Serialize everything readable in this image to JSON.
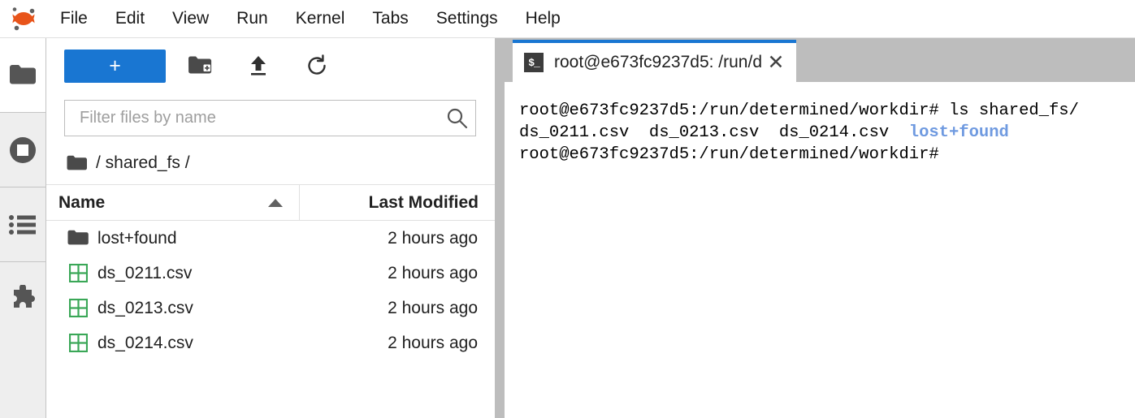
{
  "app": {
    "name": "JupyterLab",
    "logo_icon": "jupyter-logo-icon",
    "accent_color": "#1976d2",
    "logo_color": "#e8541a"
  },
  "menubar": {
    "items": [
      {
        "label": "File"
      },
      {
        "label": "Edit"
      },
      {
        "label": "View"
      },
      {
        "label": "Run"
      },
      {
        "label": "Kernel"
      },
      {
        "label": "Tabs"
      },
      {
        "label": "Settings"
      },
      {
        "label": "Help"
      }
    ]
  },
  "sidebar_rail": {
    "items": [
      {
        "icon": "folder-icon",
        "name": "file-browser",
        "active": true
      },
      {
        "icon": "running-terminals-icon",
        "name": "running-sessions",
        "active": false
      },
      {
        "icon": "list-icon",
        "name": "table-of-contents",
        "active": false
      },
      {
        "icon": "puzzle-icon",
        "name": "extension-manager",
        "active": false
      }
    ]
  },
  "file_browser": {
    "toolbar": {
      "new_launcher_label": "+",
      "new_folder_icon": "new-folder-icon",
      "upload_icon": "upload-icon",
      "refresh_icon": "refresh-icon"
    },
    "filter": {
      "placeholder": "Filter files by name",
      "value": "",
      "search_icon": "search-icon"
    },
    "breadcrumb": {
      "root_icon": "folder-icon",
      "path": "/ shared_fs /"
    },
    "columns": {
      "name": "Name",
      "last_modified": "Last Modified",
      "sort_direction": "ascending"
    },
    "files": [
      {
        "name": "lost+found",
        "modified": "2 hours ago",
        "icon": "folder-icon",
        "type": "directory"
      },
      {
        "name": "ds_0211.csv",
        "modified": "2 hours ago",
        "icon": "csv-icon",
        "type": "file"
      },
      {
        "name": "ds_0213.csv",
        "modified": "2 hours ago",
        "icon": "csv-icon",
        "type": "file"
      },
      {
        "name": "ds_0214.csv",
        "modified": "2 hours ago",
        "icon": "csv-icon",
        "type": "file"
      }
    ]
  },
  "dock": {
    "tabs": [
      {
        "title": "root@e673fc9237d5: /run/d",
        "icon": "terminal-icon",
        "close_label": "✕",
        "active": true
      }
    ],
    "terminal": {
      "prompt_color": "#000000",
      "dir_color": "#6f9ae0",
      "lines": [
        {
          "segments": [
            {
              "text": "root@e673fc9237d5:/run/determined/workdir# ls shared_fs/",
              "style": "plain"
            }
          ]
        },
        {
          "segments": [
            {
              "text": "ds_0211.csv  ds_0213.csv  ds_0214.csv  ",
              "style": "plain"
            },
            {
              "text": "lost+found",
              "style": "dir"
            }
          ]
        },
        {
          "segments": [
            {
              "text": "root@e673fc9237d5:/run/determined/workdir#",
              "style": "plain"
            }
          ]
        }
      ]
    }
  }
}
